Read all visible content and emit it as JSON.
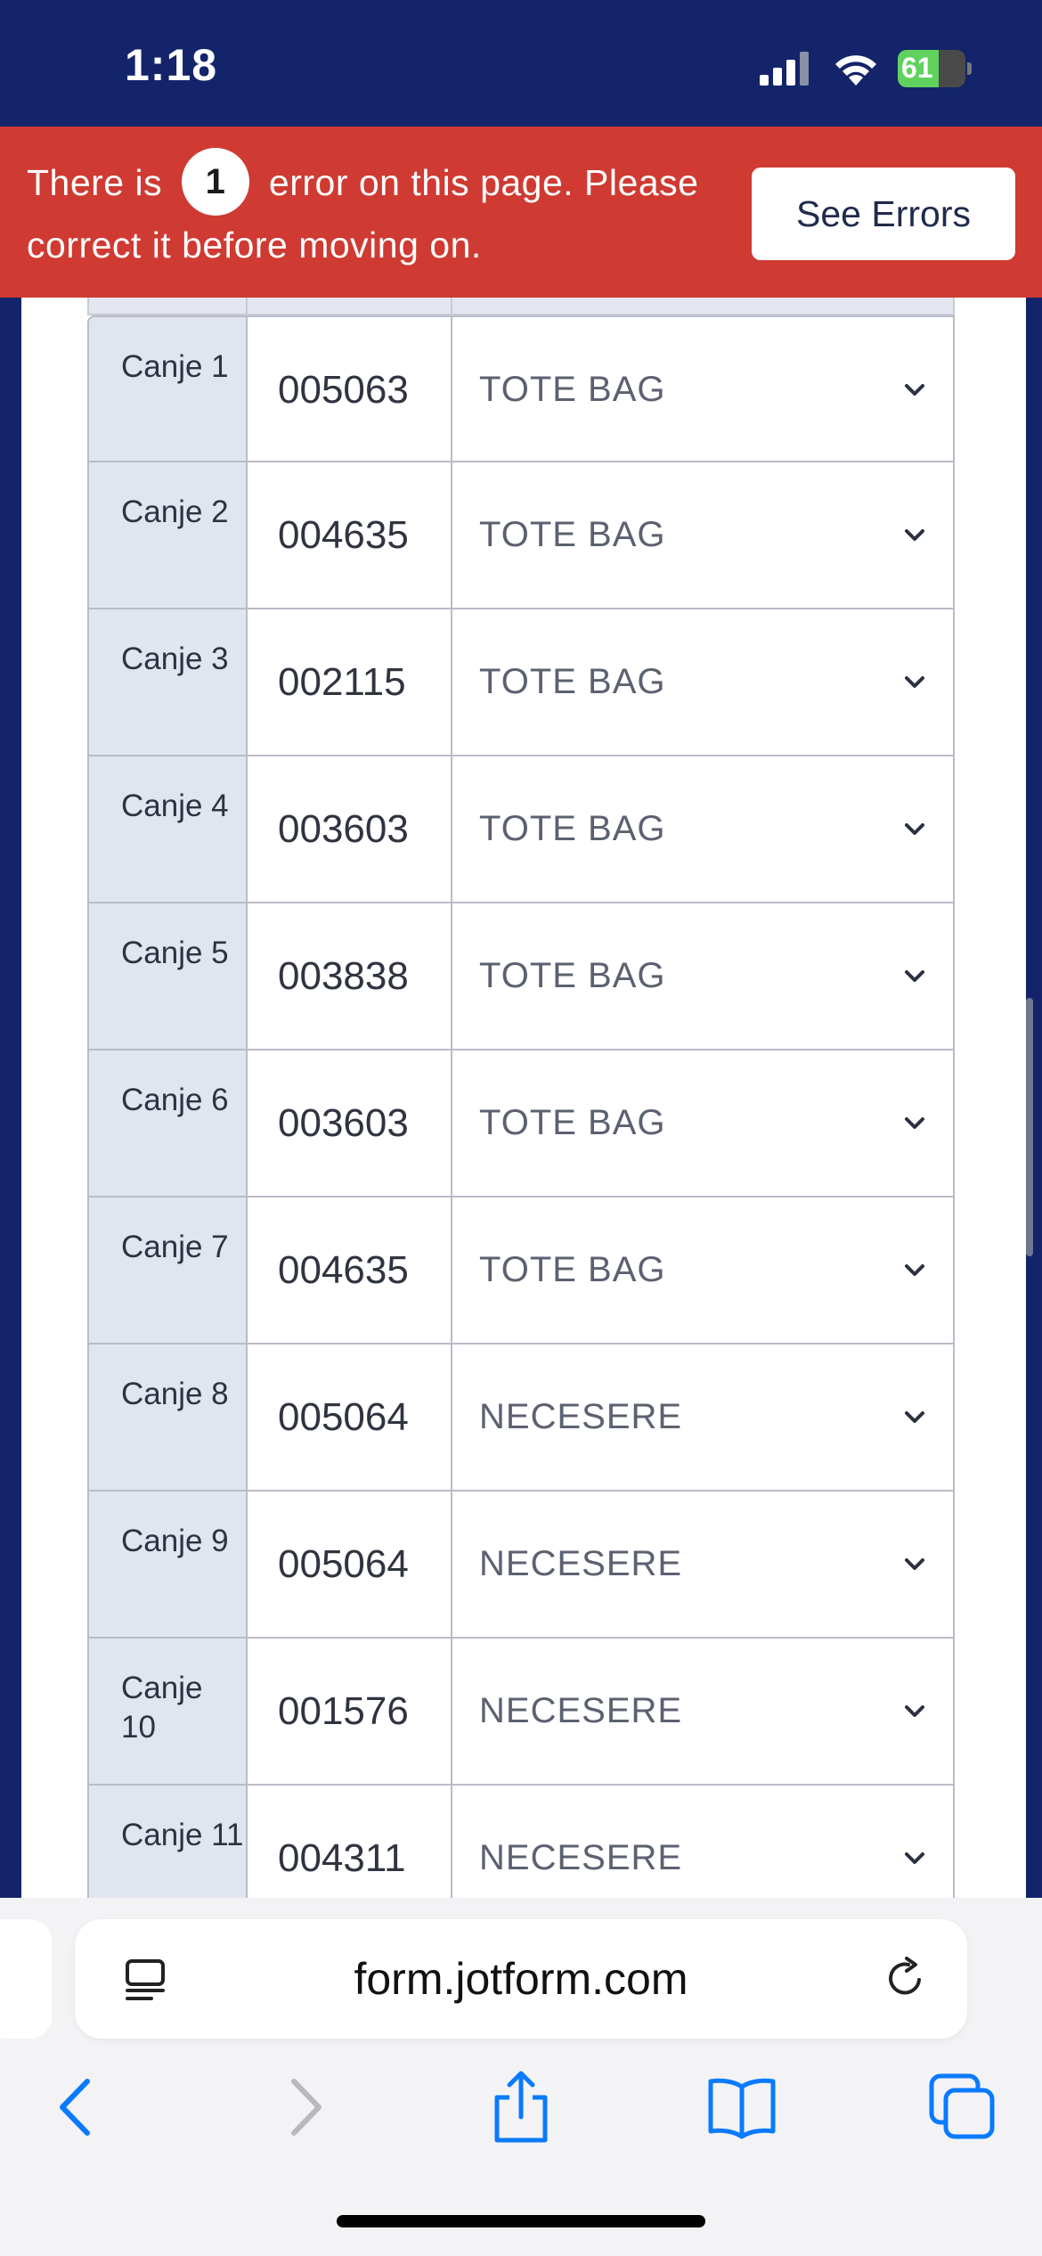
{
  "status_bar": {
    "time": "1:18",
    "battery_level": "61",
    "battery_fraction": 0.61,
    "icons": [
      "signal-icon",
      "wifi-icon",
      "battery-charging-icon"
    ]
  },
  "error_banner": {
    "text_before": "There is",
    "error_count": "1",
    "text_after": "error on this page. Please correct it before moving on.",
    "button_label": "See Errors",
    "color": "#cf3a32"
  },
  "table": {
    "rows": [
      {
        "label": "Canje 1",
        "code": "005063",
        "item": "TOTE BAG"
      },
      {
        "label": "Canje 2",
        "code": "004635",
        "item": "TOTE BAG"
      },
      {
        "label": "Canje 3",
        "code": "002115",
        "item": "TOTE BAG"
      },
      {
        "label": "Canje 4",
        "code": "003603",
        "item": "TOTE BAG"
      },
      {
        "label": "Canje 5",
        "code": "003838",
        "item": "TOTE BAG"
      },
      {
        "label": "Canje 6",
        "code": "003603",
        "item": "TOTE BAG"
      },
      {
        "label": "Canje 7",
        "code": "004635",
        "item": "TOTE BAG"
      },
      {
        "label": "Canje 8",
        "code": "005064",
        "item": "NECESERE"
      },
      {
        "label": "Canje 9",
        "code": "005064",
        "item": "NECESERE"
      },
      {
        "label": "Canje 10",
        "code": "001576",
        "item": "NECESERE"
      },
      {
        "label": "Canje 11",
        "code": "004311",
        "item": "NECESERE"
      }
    ]
  },
  "browser": {
    "url": "form.jotform.com",
    "toolbar_icons": [
      "back-icon",
      "forward-icon",
      "share-icon",
      "bookmarks-icon",
      "tabs-icon"
    ]
  },
  "colors": {
    "page_background": "#13246a",
    "label_cell": "#e1e5ef",
    "border": "#b8bcc8",
    "ios_blue": "#0a7aff"
  }
}
